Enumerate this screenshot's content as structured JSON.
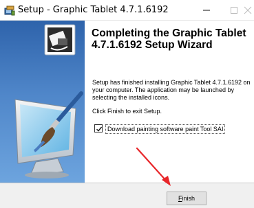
{
  "window": {
    "title": "Setup - Graphic Tablet 4.7.1.6192",
    "app_icon": "installer-icon",
    "controls": [
      "minimize-icon",
      "maximize-icon",
      "close-icon"
    ]
  },
  "wizard": {
    "heading": "Completing the Graphic Tablet 4.7.1.6192 Setup Wizard",
    "description": "Setup has finished installing Graphic Tablet 4.7.1.6192 on your computer. The application may be launched by selecting the installed icons.",
    "finish_note": "Click Finish to exit Setup.",
    "checkbox": {
      "label": "Download painting software paint Tool SAI",
      "checked": true
    }
  },
  "footer": {
    "finish_label_accel": "F",
    "finish_label_rest": "inish"
  },
  "annotation": {
    "arrow_color": "#e8262a"
  }
}
